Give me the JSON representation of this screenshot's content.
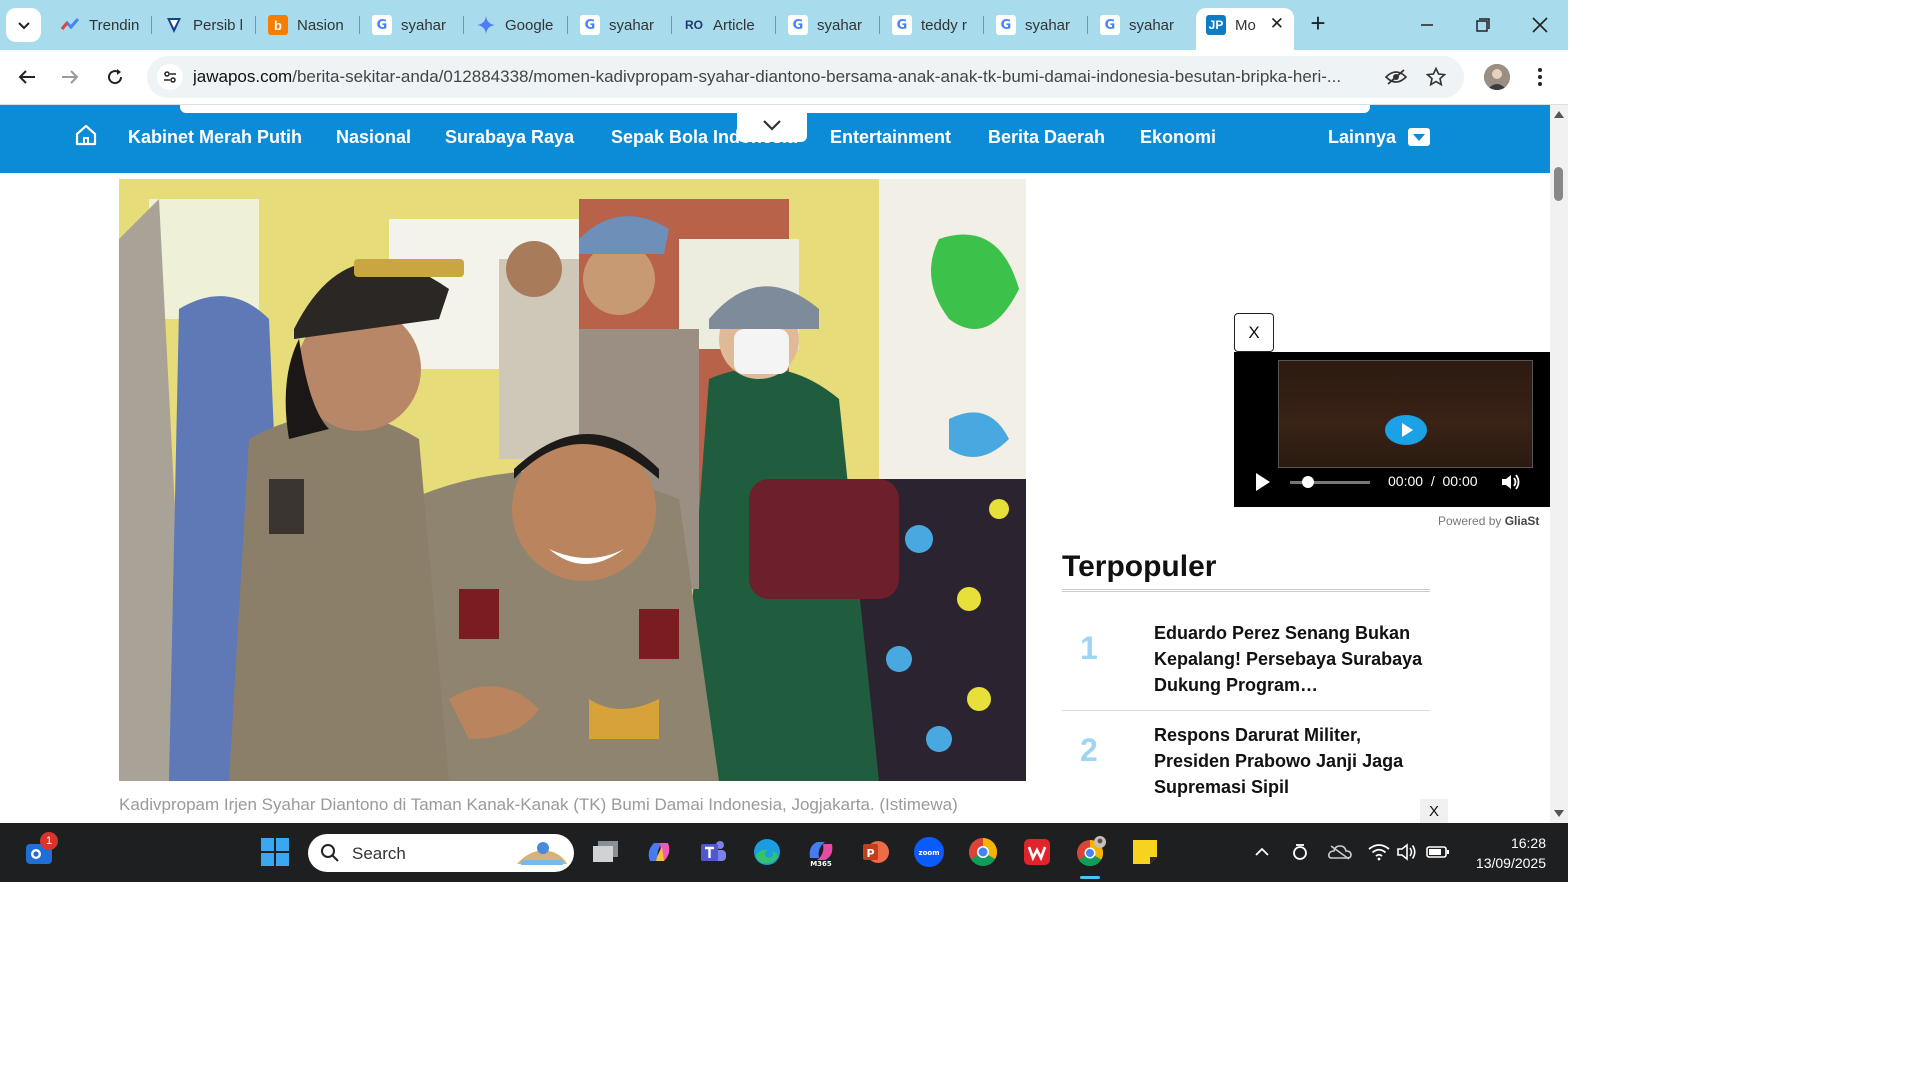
{
  "browser": {
    "tabs": [
      {
        "title": "Trendin",
        "icon": "trends-icon"
      },
      {
        "title": "Persib l",
        "icon": "persib-icon"
      },
      {
        "title": "Nasion",
        "icon": "blogger-icon"
      },
      {
        "title": "syahar",
        "icon": "google-icon"
      },
      {
        "title": "Google",
        "icon": "gemini-icon"
      },
      {
        "title": "syahar",
        "icon": "google-icon"
      },
      {
        "title": "Article",
        "icon": "article-icon"
      },
      {
        "title": "syahar",
        "icon": "google-icon"
      },
      {
        "title": "teddy r",
        "icon": "google-icon"
      },
      {
        "title": "syahar",
        "icon": "google-icon"
      },
      {
        "title": "syahar",
        "icon": "google-icon"
      },
      {
        "title": "Mo",
        "icon": "jawapos-icon",
        "fav_text": "JP",
        "active": true
      }
    ],
    "url_host": "jawapos.com",
    "url_path": "/berita-sekitar-anda/012884338/momen-kadivpropam-syahar-diantono-bersama-anak-anak-tk-bumi-damai-indonesia-besutan-bripka-heri-..."
  },
  "site_nav": {
    "items": [
      "Kabinet Merah Putih",
      "Nasional",
      "Surabaya Raya",
      "Sepak Bola Indonesia",
      "Entertainment",
      "Berita Daerah",
      "Ekonomi"
    ],
    "more_label": "Lainnya"
  },
  "article": {
    "caption": "Kadivpropam Irjen Syahar Diantono di Taman Kanak-Kanak (TK) Bumi Damai Indonesia, Jogjakarta. (Istimewa)"
  },
  "video_ad": {
    "close_label": "X",
    "current_time": "00:00",
    "duration": "00:00",
    "separator": "/",
    "powered_by_prefix": "Powered by",
    "powered_by_brand": "GliaSt"
  },
  "popular": {
    "title": "Terpopuler",
    "items": [
      {
        "rank": "1",
        "headline": "Eduardo Perez Senang Bukan Kepalang! Persebaya Surabaya Dukung Program…"
      },
      {
        "rank": "2",
        "headline": "Respons Darurat Militer, Presiden Prabowo Janji Jaga Supremasi Sipil"
      }
    ],
    "close_label": "X"
  },
  "taskbar": {
    "search_placeholder": "Search",
    "notification_count": "1",
    "time": "16:28",
    "date": "13/09/2025"
  },
  "colors": {
    "tabstrip": "#a8dcec",
    "nav_blue": "#0c8bd7",
    "rank_blue": "#9fd5f2",
    "taskbar": "#1d1f20"
  }
}
